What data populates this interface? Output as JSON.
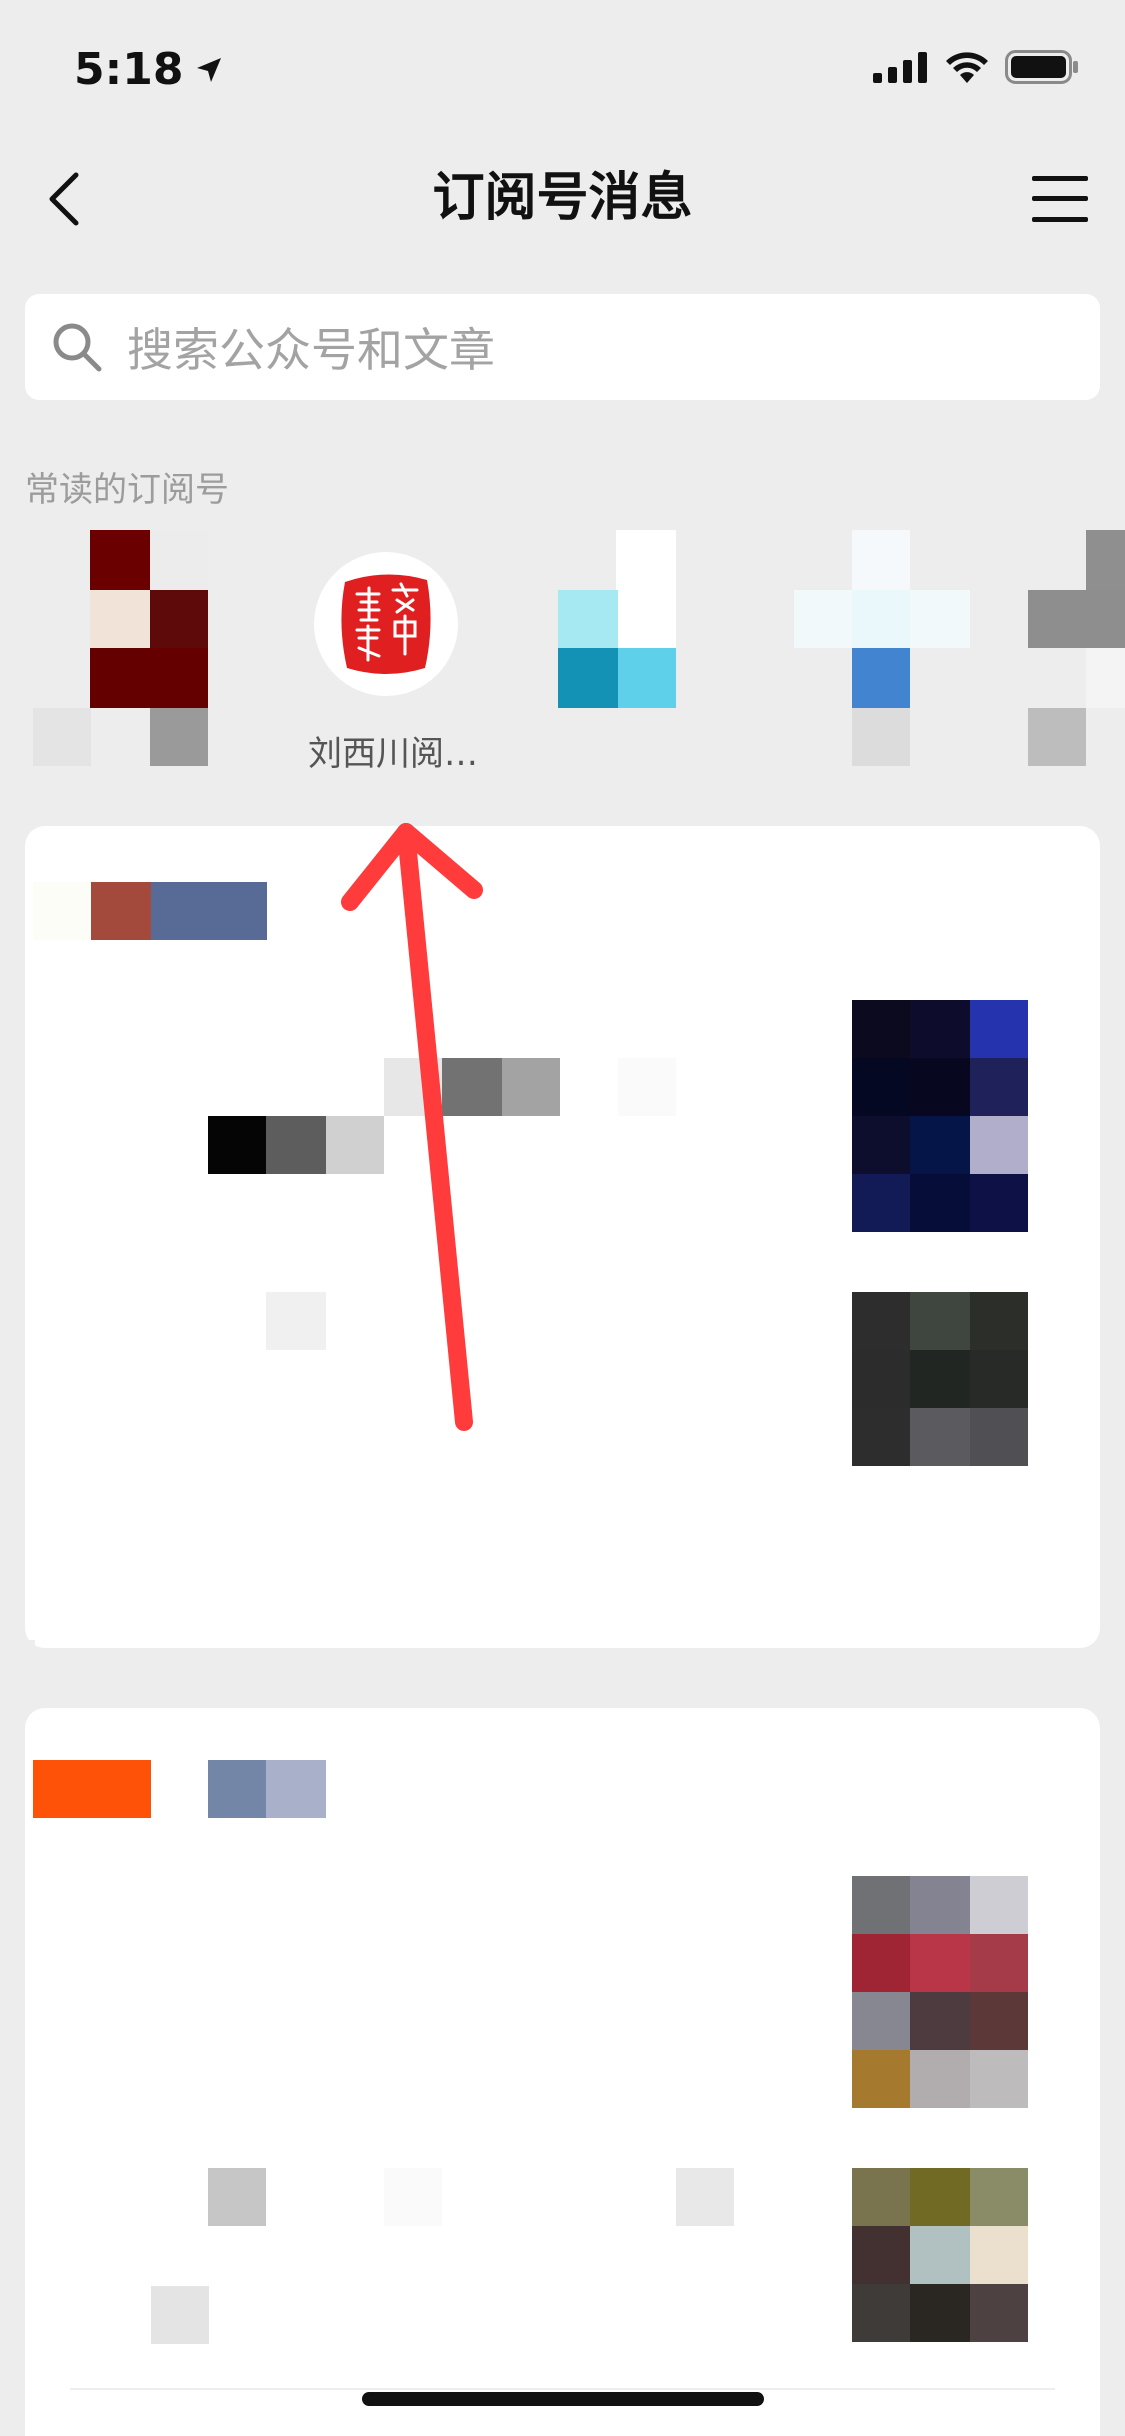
{
  "status_bar": {
    "time": "5:18",
    "icons": [
      "location-arrow-icon",
      "cellular-signal-icon",
      "wifi-icon",
      "battery-icon"
    ]
  },
  "nav": {
    "title": "订阅号消息",
    "back_icon": "chevron-left-icon",
    "menu_icon": "hamburger-menu-icon"
  },
  "search": {
    "placeholder": "搜索公众号和文章",
    "icon": "search-icon"
  },
  "frequent": {
    "label": "常读的订阅号",
    "items": [
      {
        "name": "",
        "blurred": true
      },
      {
        "name": "刘西川阅…",
        "blurred": false,
        "seal_color": "#e02020"
      },
      {
        "name": "",
        "blurred": true
      },
      {
        "name": "",
        "blurred": true
      },
      {
        "name": "",
        "blurred": true
      }
    ]
  },
  "colors": {
    "background": "#ededed",
    "card": "#ffffff",
    "annotation_arrow": "#ff3b3b",
    "placeholder_text": "#a3a3a3"
  },
  "annotation": {
    "type": "arrow",
    "points_to": "frequent-item-liuxichuan"
  }
}
